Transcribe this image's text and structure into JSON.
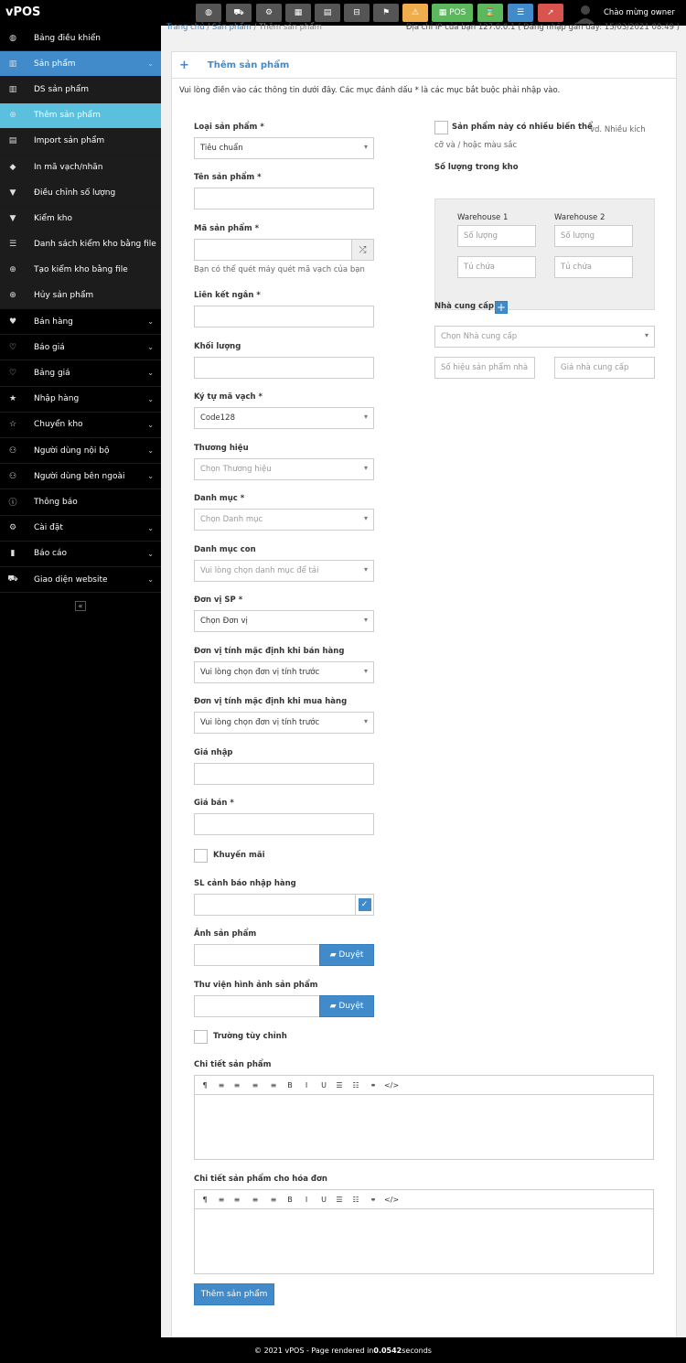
{
  "app": {
    "brand": "vPOS",
    "welcome": "Chào mừng owner"
  },
  "toolbar": {
    "pos_label": "POS",
    "icons": [
      "dashboard-icon",
      "cart-icon",
      "settings-icon",
      "calculator-icon",
      "calendar-icon",
      "register-icon",
      "flag-icon",
      "alert-icon",
      "pos-icon",
      "hourglass-icon",
      "list-icon",
      "logout-icon"
    ]
  },
  "sidebar": {
    "items": [
      {
        "label": "Bảng điều khiển",
        "icon": "dashboard-icon",
        "glyph": "◍"
      },
      {
        "label": "Sản phẩm",
        "icon": "barcode-icon",
        "glyph": "▥",
        "chev": "⌄",
        "state": "active"
      },
      {
        "label": "DS sản phẩm",
        "icon": "barcode-icon",
        "glyph": "▥",
        "state": "sub"
      },
      {
        "label": "Thêm sản phẩm",
        "icon": "plus-circle-icon",
        "glyph": "⊕",
        "state": "cur"
      },
      {
        "label": "Import sản phẩm",
        "icon": "file-icon",
        "glyph": "▤",
        "state": "sub"
      },
      {
        "label": "In mã vạch/nhãn",
        "icon": "tags-icon",
        "glyph": "◆",
        "state": "sub"
      },
      {
        "label": "Điều chỉnh số lượng",
        "icon": "filter-icon",
        "glyph": "▼",
        "state": "sub"
      },
      {
        "label": "Kiểm kho",
        "icon": "filter-icon",
        "glyph": "▼",
        "state": "sub"
      },
      {
        "label": "Danh sách kiểm kho bằng file",
        "icon": "list-icon",
        "glyph": "☰",
        "state": "sub"
      },
      {
        "label": "Tạo kiểm kho bằng file",
        "icon": "plus-circle-icon",
        "glyph": "⊕",
        "state": "sub"
      },
      {
        "label": "Hủy sản phẩm",
        "icon": "plus-circle-icon",
        "glyph": "⊕",
        "state": "sub"
      },
      {
        "label": "Bán hàng",
        "icon": "heart-icon",
        "glyph": "♥",
        "chev": "⌄"
      },
      {
        "label": "Báo giá",
        "icon": "heart-outline-icon",
        "glyph": "♡",
        "chev": "⌄"
      },
      {
        "label": "Bảng giá",
        "icon": "heart-outline-icon",
        "glyph": "♡",
        "chev": "⌄"
      },
      {
        "label": "Nhập hàng",
        "icon": "star-icon",
        "glyph": "★",
        "chev": "⌄"
      },
      {
        "label": "Chuyển kho",
        "icon": "star-outline-icon",
        "glyph": "☆",
        "chev": "⌄"
      },
      {
        "label": "Người dùng nội bộ",
        "icon": "users-icon",
        "glyph": "⚇",
        "chev": "⌄"
      },
      {
        "label": "Người dùng bên ngoài",
        "icon": "users-icon",
        "glyph": "⚇",
        "chev": "⌄"
      },
      {
        "label": "Thông báo",
        "icon": "info-icon",
        "glyph": "ⓘ"
      },
      {
        "label": "Cài đặt",
        "icon": "gear-icon",
        "glyph": "⚙",
        "chev": "⌄"
      },
      {
        "label": "Báo cáo",
        "icon": "bar-chart-icon",
        "glyph": "▮",
        "chev": "⌄"
      },
      {
        "label": "Giao diện website",
        "icon": "cart-icon",
        "glyph": "⛟",
        "chev": "⌄"
      }
    ],
    "collapse": "«"
  },
  "breadcrumb": {
    "home": "Trang chủ",
    "sep": "/",
    "products": "Sản phẩm",
    "current": "Thêm sản phẩm"
  },
  "ip_info": "Địa chỉ IP của bạn 127.0.0.1 ( Đăng nhập gần đây: 15/03/2021 08:49 )",
  "panel": {
    "title": "Thêm sản phẩm",
    "intro": "Vui lòng điền vào các thông tin dưới đây. Các mục đánh dấu * là các mục bắt buộc phải nhập vào."
  },
  "form": {
    "type": {
      "label": "Loại sản phẩm *",
      "value": "Tiêu chuẩn"
    },
    "name": {
      "label": "Tên sản phẩm *",
      "value": ""
    },
    "code": {
      "label": "Mã sản phẩm *",
      "value": "",
      "help": "Bạn có thể quét máy quét mã vạch của bạn"
    },
    "slug": {
      "label": "Liên kết ngắn *",
      "value": ""
    },
    "weight": {
      "label": "Khối lượng",
      "value": ""
    },
    "barcode": {
      "label": "Ký tự mã vạch *",
      "value": "Code128"
    },
    "brand": {
      "label": "Thương hiệu",
      "placeholder": "Chọn Thương hiệu"
    },
    "category": {
      "label": "Danh mục *",
      "placeholder": "Chọn Danh mục"
    },
    "subcategory": {
      "label": "Danh mục con",
      "placeholder": "Vui lòng chọn danh mục để tải"
    },
    "unit": {
      "label": "Đơn vị SP *",
      "value": "Chọn Đơn vị"
    },
    "sale_unit": {
      "label": "Đơn vị tính mặc định khi bán hàng",
      "value": "Vui lòng chọn đơn vị tính trước"
    },
    "purchase_unit": {
      "label": "Đơn vị tính mặc định khi mua hàng",
      "value": "Vui lòng chọn đơn vị tính trước"
    },
    "cost": {
      "label": "Giá nhập",
      "value": ""
    },
    "price": {
      "label": "Giá bán *",
      "value": ""
    },
    "promotion": {
      "label": "Khuyến mãi"
    },
    "alert_qty": {
      "label": "SL cảnh báo nhập hàng",
      "value": ""
    },
    "image": {
      "label": "Ảnh sản phẩm",
      "button": "Duyệt"
    },
    "gallery": {
      "label": "Thư viện hình ảnh sản phẩm",
      "button": "Duyệt"
    },
    "custom_fields": {
      "label": "Trường tùy chỉnh"
    },
    "details": {
      "label": "Chi tiết sản phẩm"
    },
    "invoice_details": {
      "label": "Chi tiết sản phẩm cho hóa đơn"
    },
    "submit": "Thêm sản phẩm"
  },
  "right": {
    "variants": {
      "label": "Sản phẩm này có nhiều biến thể",
      "help": "vd. Nhiều kích cỡ và / hoặc màu sắc"
    },
    "stock": {
      "label": "Số lượng trong kho",
      "warehouses": [
        {
          "name": "Warehouse 1",
          "qty_placeholder": "Số lượng",
          "rack_placeholder": "Tủ chứa"
        },
        {
          "name": "Warehouse 2",
          "qty_placeholder": "Số lượng",
          "rack_placeholder": "Tủ chứa"
        }
      ]
    },
    "supplier": {
      "label": "Nhà cung cấp",
      "placeholder": "Chọn Nhà cung cấp",
      "part_no_placeholder": "Số hiệu sản phẩm nhà",
      "price_placeholder": "Giá nhà cung cấp"
    }
  },
  "editor_tools": [
    "¶",
    "≡",
    "≡",
    "≡",
    "≡",
    "B",
    "I",
    "U",
    "☰",
    "☷",
    "⚭",
    "</>"
  ],
  "footer": {
    "prefix": "© 2021 vPOS - Page rendered in ",
    "time": "0.0542",
    "suffix": " seconds"
  }
}
